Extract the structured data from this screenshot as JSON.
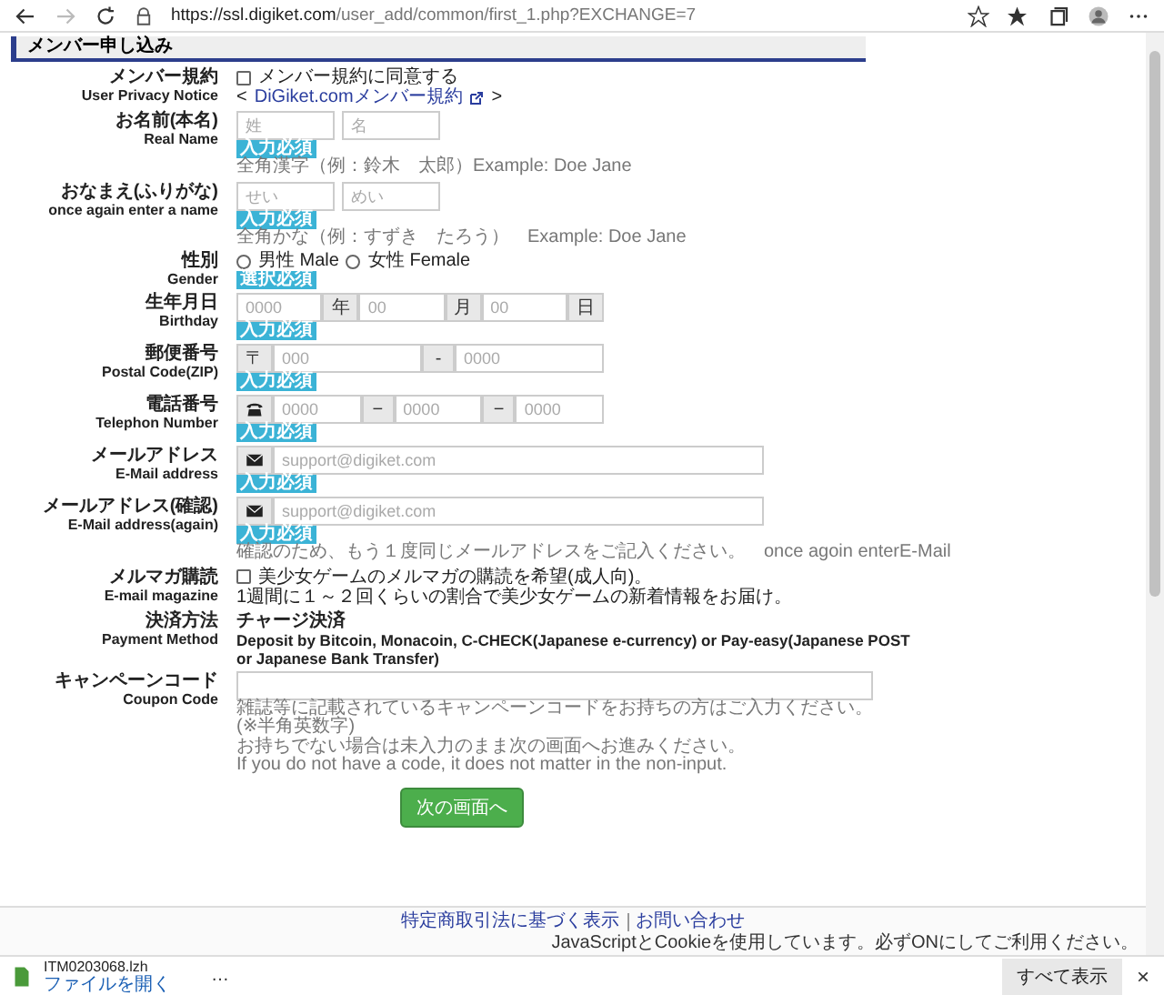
{
  "browser": {
    "url_host": "https://ssl.digiket.com",
    "url_path": "/user_add/common/first_1.php?EXCHANGE=7"
  },
  "heading": "メンバー申し込み",
  "rows": [
    {
      "kind": "agree",
      "label_ja": "メンバー規約",
      "label_en": "User Privacy Notice",
      "checkbox": {
        "label": "メンバー規約に同意する",
        "checked": false
      },
      "link_open": "<",
      "link": "DiGiket.comメンバー規約",
      "link_close": ">"
    },
    {
      "kind": "pair",
      "label_ja": "お名前(本名)",
      "label_en": "Real Name",
      "parts": [
        {
          "placeholder": "姓"
        },
        {
          "placeholder": "名"
        }
      ],
      "badge": "入力必須",
      "notes": [
        "全角漢字（例：鈴木　太郎）Example: Doe Jane"
      ]
    },
    {
      "kind": "pair",
      "label_ja": "おなまえ(ふりがな)",
      "label_en": "once again enter a name",
      "parts": [
        {
          "placeholder": "せい"
        },
        {
          "placeholder": "めい"
        }
      ],
      "badge": "入力必須",
      "notes": [
        "全角かな（例：すずき　たろう）　Example: Doe Jane"
      ]
    },
    {
      "kind": "radios",
      "label_ja": "性別",
      "label_en": "Gender",
      "options": [
        {
          "label": "男性 Male",
          "selected": false
        },
        {
          "label": "女性 Female",
          "selected": false
        }
      ],
      "badge": "選択必須"
    },
    {
      "kind": "group",
      "label_ja": "生年月日",
      "label_en": "Birthday",
      "parts": [
        {
          "placeholder": "0000"
        },
        {
          "addon": "年"
        },
        {
          "placeholder": "00"
        },
        {
          "addon": "月"
        },
        {
          "placeholder": "00"
        },
        {
          "addon": "日"
        }
      ],
      "badge": "入力必須"
    },
    {
      "kind": "group",
      "label_ja": "郵便番号",
      "label_en": "Postal Code(ZIP)",
      "parts": [
        {
          "addon": "〒"
        },
        {
          "placeholder": "000"
        },
        {
          "addon": "-"
        },
        {
          "placeholder": "0000"
        }
      ],
      "badge": "入力必須"
    },
    {
      "kind": "group",
      "label_ja": "電話番号",
      "label_en": "Telephon Number",
      "parts": [
        {
          "kind": "phone"
        },
        {
          "placeholder": "0000"
        },
        {
          "addon": "−"
        },
        {
          "placeholder": "0000"
        },
        {
          "addon": "−"
        },
        {
          "placeholder": "0000"
        }
      ],
      "badge": "入力必須"
    },
    {
      "kind": "email",
      "label_ja": "メールアドレス",
      "label_en": "E-Mail address",
      "parts": [
        {
          "kind": "mail"
        },
        {
          "placeholder": "support@digiket.com"
        }
      ],
      "badge": "入力必須"
    },
    {
      "kind": "email",
      "label_ja": "メールアドレス(確認)",
      "label_en": "E-Mail address(again)",
      "parts": [
        {
          "kind": "mail"
        },
        {
          "placeholder": "support@digiket.com"
        }
      ],
      "badge": "入力必須",
      "notes": [
        "確認のため、もう１度同じメールアドレスをご記入ください。　once agoin enterE-Mail"
      ]
    },
    {
      "kind": "optin",
      "label_ja": "メルマガ購読",
      "label_en": "E-mail magazine",
      "checkbox": {
        "label": "美少女ゲームのメルマガの購読を希望(成人向)。",
        "checked": false
      },
      "notes": [
        "1週間に１～２回くらいの割合で美少女ゲームの新着情報をお届け。"
      ]
    },
    {
      "kind": "info",
      "label_ja": "決済方法",
      "label_en": "Payment Method",
      "title": "チャージ決済",
      "body": "Deposit by Bitcoin, Monacoin, C-CHECK(Japanese e-currency) or Pay-easy(Japanese POST or Japanese Bank Transfer)"
    },
    {
      "kind": "coupon",
      "label_ja": "キャンペーンコード",
      "label_en": "Coupon Code",
      "notes": [
        "雑誌等に記載されているキャンペーンコードをお持ちの方はご入力ください。",
        "(※半角英数字)",
        "お持ちでない場合は未入力のまま次の画面へお進みください。",
        "If you do not have a code, it does not matter in the non-input."
      ]
    }
  ],
  "submit": "次の画面へ",
  "footer": {
    "links": [
      "特定商取引法に基づく表示",
      "お問い合わせ"
    ],
    "notice": "JavaScriptとCookieを使用しています。必ずONにしてご利用ください。"
  },
  "download": {
    "file": "ITM0203068.lzh",
    "action": "ファイルを開く",
    "more": "…",
    "show_all": "すべて表示",
    "close": "×"
  }
}
